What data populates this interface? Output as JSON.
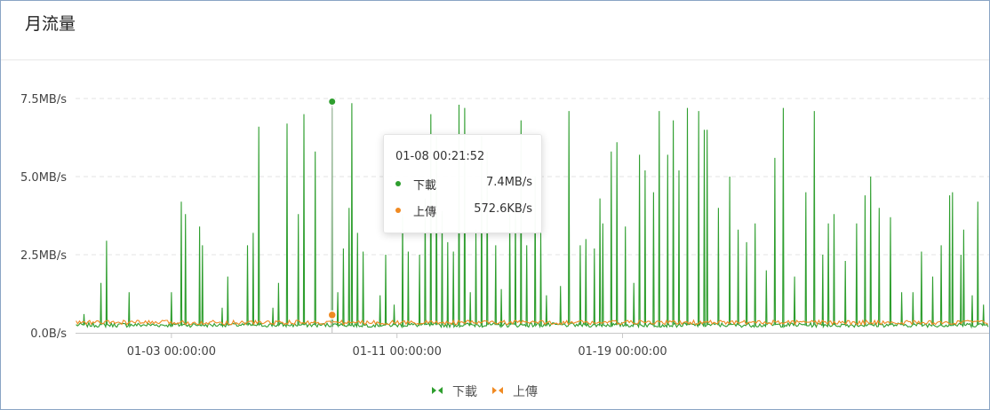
{
  "title": "月流量",
  "colors": {
    "download": "#2e9e2e",
    "upload": "#f08a22",
    "grid": "#e3e3e3"
  },
  "chart_data": {
    "type": "line",
    "ylabel": "",
    "y_unit": "MB/s",
    "ylim": [
      0,
      9.0
    ],
    "y_ticks": [
      {
        "label": "0.0B/s",
        "value": 0
      },
      {
        "label": "2.5MB/s",
        "value": 2.5
      },
      {
        "label": "5.0MB/s",
        "value": 5.0
      },
      {
        "label": "7.5MB/s",
        "value": 7.5
      }
    ],
    "x_range_days": [
      -1.4,
      31.0
    ],
    "x_ticks": [
      {
        "label": "01-03 00:00:00",
        "day": 2
      },
      {
        "label": "01-11 00:00:00",
        "day": 10
      },
      {
        "label": "01-19 00:00:00",
        "day": 18
      }
    ],
    "series": [
      {
        "name": "下載",
        "color": "#2e9e2e",
        "baseline": 0.25,
        "spikes_day_value": [
          [
            -1.1,
            0.6
          ],
          [
            -0.5,
            1.6
          ],
          [
            -0.3,
            2.95
          ],
          [
            0.5,
            1.3
          ],
          [
            2.0,
            1.3
          ],
          [
            2.35,
            4.2
          ],
          [
            2.5,
            3.8
          ],
          [
            3.0,
            3.4
          ],
          [
            3.1,
            2.8
          ],
          [
            3.8,
            0.8
          ],
          [
            4.0,
            1.8
          ],
          [
            4.7,
            2.8
          ],
          [
            4.9,
            3.2
          ],
          [
            5.1,
            6.6
          ],
          [
            5.6,
            0.8
          ],
          [
            5.8,
            1.6
          ],
          [
            6.1,
            6.7
          ],
          [
            6.5,
            3.8
          ],
          [
            6.7,
            7.0
          ],
          [
            7.1,
            5.8
          ],
          [
            7.7,
            7.2
          ],
          [
            7.9,
            1.3
          ],
          [
            8.1,
            2.7
          ],
          [
            8.3,
            4.0
          ],
          [
            8.4,
            7.35
          ],
          [
            8.6,
            3.2
          ],
          [
            8.8,
            2.6
          ],
          [
            9.4,
            1.2
          ],
          [
            9.6,
            2.5
          ],
          [
            9.9,
            0.9
          ],
          [
            10.2,
            3.8
          ],
          [
            10.4,
            2.6
          ],
          [
            10.8,
            2.5
          ],
          [
            11.0,
            4.3
          ],
          [
            11.2,
            7.0
          ],
          [
            11.4,
            6.3
          ],
          [
            11.6,
            3.9
          ],
          [
            11.8,
            2.9
          ],
          [
            12.0,
            2.6
          ],
          [
            12.2,
            7.3
          ],
          [
            12.4,
            7.2
          ],
          [
            12.6,
            1.3
          ],
          [
            12.8,
            3.3
          ],
          [
            13.0,
            6.3
          ],
          [
            13.2,
            5.8
          ],
          [
            13.5,
            2.8
          ],
          [
            13.7,
            1.4
          ],
          [
            14.0,
            3.8
          ],
          [
            14.2,
            4.2
          ],
          [
            14.4,
            6.8
          ],
          [
            14.6,
            2.8
          ],
          [
            14.9,
            5.0
          ],
          [
            15.1,
            3.2
          ],
          [
            15.3,
            1.2
          ],
          [
            15.8,
            1.5
          ],
          [
            16.1,
            7.1
          ],
          [
            16.5,
            2.8
          ],
          [
            16.7,
            3.0
          ],
          [
            17.0,
            2.7
          ],
          [
            17.2,
            4.3
          ],
          [
            17.3,
            3.5
          ],
          [
            17.6,
            5.8
          ],
          [
            17.8,
            6.1
          ],
          [
            18.1,
            3.4
          ],
          [
            18.4,
            1.6
          ],
          [
            18.6,
            5.7
          ],
          [
            18.8,
            5.2
          ],
          [
            19.1,
            4.5
          ],
          [
            19.3,
            7.1
          ],
          [
            19.6,
            5.7
          ],
          [
            19.8,
            6.8
          ],
          [
            20.0,
            5.2
          ],
          [
            20.3,
            7.2
          ],
          [
            20.7,
            7.1
          ],
          [
            20.9,
            6.5
          ],
          [
            21.0,
            6.5
          ],
          [
            21.4,
            4.0
          ],
          [
            21.8,
            5.0
          ],
          [
            22.1,
            3.3
          ],
          [
            22.4,
            2.9
          ],
          [
            22.7,
            3.5
          ],
          [
            23.1,
            2.0
          ],
          [
            23.4,
            5.6
          ],
          [
            23.7,
            7.2
          ],
          [
            24.1,
            1.8
          ],
          [
            24.5,
            4.5
          ],
          [
            24.8,
            7.1
          ],
          [
            25.1,
            2.5
          ],
          [
            25.3,
            3.5
          ],
          [
            25.5,
            3.8
          ],
          [
            25.9,
            2.3
          ],
          [
            26.3,
            3.5
          ],
          [
            26.6,
            4.4
          ],
          [
            26.8,
            5.0
          ],
          [
            27.1,
            4.0
          ],
          [
            27.5,
            3.7
          ],
          [
            27.9,
            1.3
          ],
          [
            28.3,
            1.3
          ],
          [
            28.6,
            2.6
          ],
          [
            29.0,
            1.8
          ],
          [
            29.3,
            2.8
          ],
          [
            29.6,
            4.4
          ],
          [
            29.7,
            4.5
          ],
          [
            30.0,
            2.5
          ],
          [
            30.1,
            3.3
          ],
          [
            30.4,
            1.2
          ],
          [
            30.6,
            4.2
          ],
          [
            30.8,
            0.9
          ]
        ]
      },
      {
        "name": "上傳",
        "color": "#f08a22",
        "baseline": 0.33,
        "noise": 0.07
      }
    ],
    "highlight": {
      "time": "01-08 00:21:52",
      "day": 7.7,
      "values": [
        "7.4MB/s",
        "572.6KB/s"
      ]
    },
    "legend_position": "bottom-center"
  },
  "tooltip": {
    "time": "01-08 00:21:52",
    "rows": [
      {
        "name": "下載",
        "value": "7.4MB/s"
      },
      {
        "name": "上傳",
        "value": "572.6KB/s"
      }
    ]
  },
  "legend": [
    {
      "name": "下載"
    },
    {
      "name": "上傳"
    }
  ]
}
